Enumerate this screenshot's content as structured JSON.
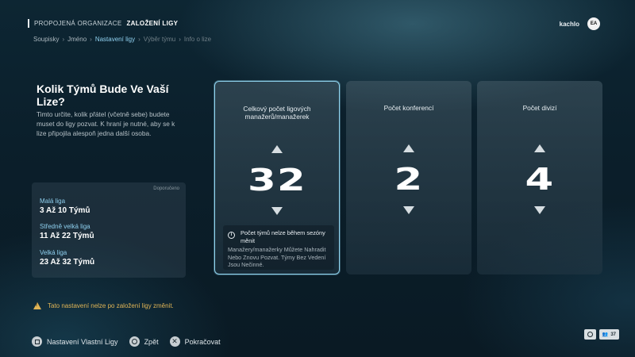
{
  "header": {
    "org_prefix": "PROPOJENÁ ORGANIZACE",
    "org_title": "ZALOŽENÍ LIGY",
    "username": "kachlo",
    "logo_text": "EA"
  },
  "breadcrumb": [
    {
      "label": "Soupisky"
    },
    {
      "label": "Jméno"
    },
    {
      "label": "Nastavení ligy"
    },
    {
      "label": "Výběr týmu"
    },
    {
      "label": "Info o lize"
    }
  ],
  "left": {
    "question": "Kolik Týmů Bude Ve Vaší Lize?",
    "description": "Timto určite, kolik přátel (včetně sebe) budete muset do ligy pozvat. K hraní je nutné, aby se k lize připojila alespoň jedna další osoba.",
    "recommended_label": "Doporučeno",
    "leagues": [
      {
        "name": "Malá liga",
        "range": "3 Až 10 Týmů"
      },
      {
        "name": "Středně velká liga",
        "range": "11 Až 22 Týmů"
      },
      {
        "name": "Velká liga",
        "range": "23 Až 32 Týmů"
      }
    ]
  },
  "cards": [
    {
      "title": "Celkový počet ligových manažerů/manažerek",
      "value": "32",
      "info_title": "Počet týmů nelze během sezóny měnit",
      "info_text": "Manažery/manažerky Můžete Nahradit Nebo Znovu Pozvat. Týmy Bez Vedení Jsou Nečinné."
    },
    {
      "title": "Počet konferencí",
      "value": "2"
    },
    {
      "title": "Počet divizí",
      "value": "4"
    }
  ],
  "warning": "Tato nastavení nelze po založení ligy změnit.",
  "footer": {
    "buttons": [
      {
        "label": "Nastavení Vlastní Ligy"
      },
      {
        "label": "Zpět"
      },
      {
        "label": "Pokračovat"
      }
    ],
    "player_count": "37"
  },
  "colors": {
    "accent": "#8fd0ef",
    "warning": "#e0b455",
    "background": "#0b1f2b"
  }
}
